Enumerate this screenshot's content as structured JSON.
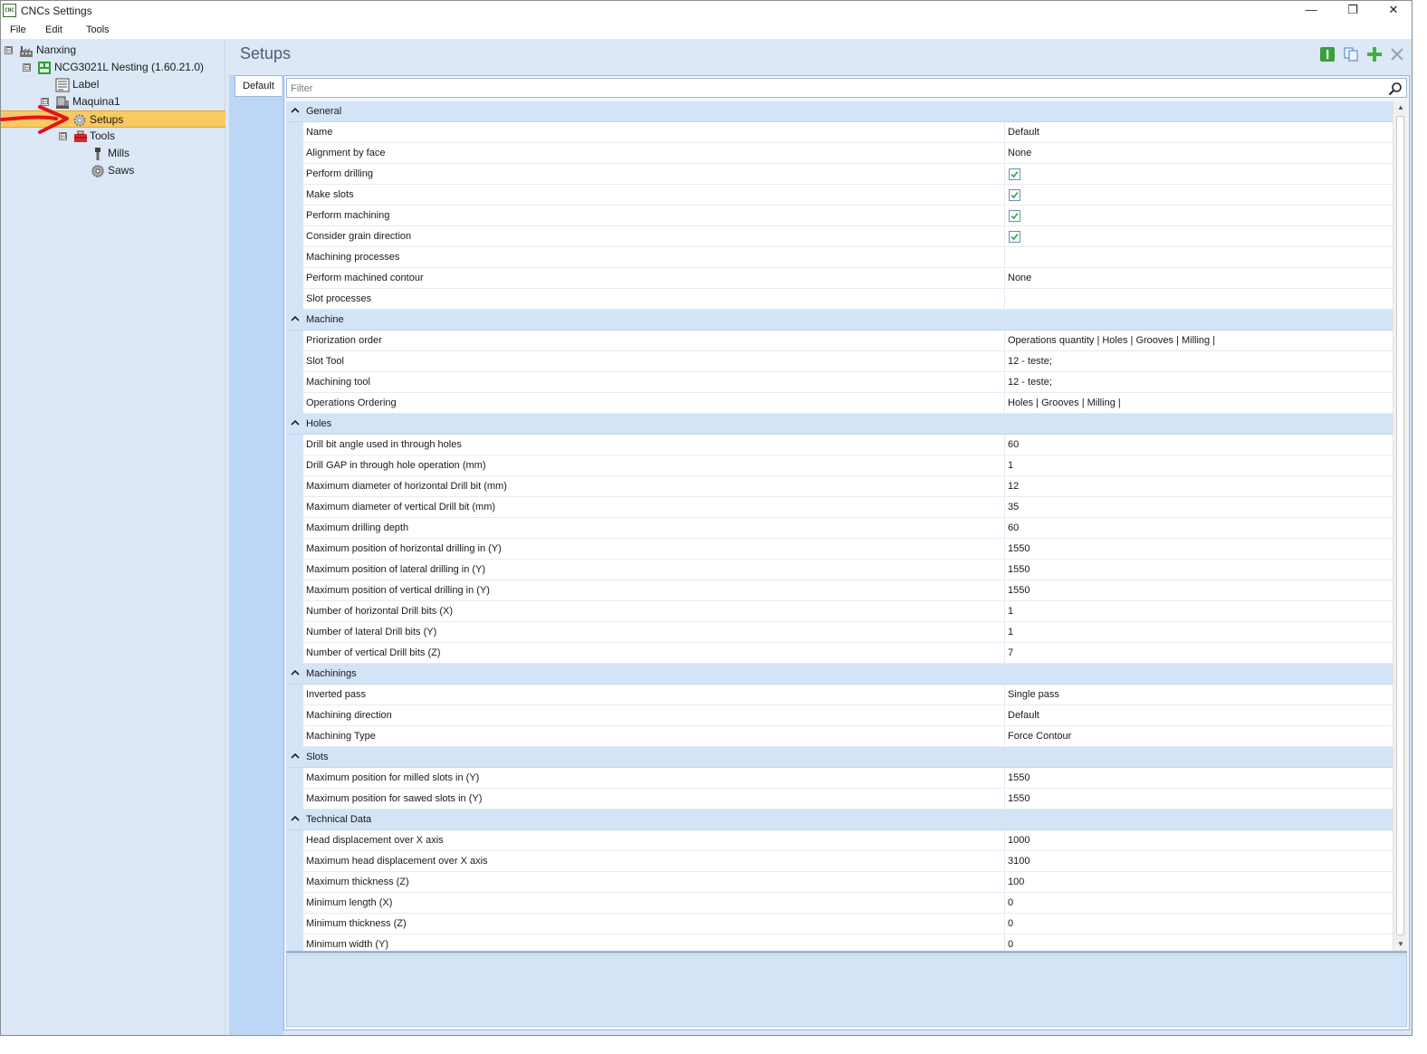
{
  "window": {
    "app_icon_text": "CNC",
    "title": "CNCs Settings",
    "minimize_symbol": "—",
    "restore_symbol": "❐",
    "close_symbol": "✕"
  },
  "menu": {
    "items": [
      "File",
      "Edit",
      "Tools"
    ]
  },
  "tree": {
    "nodes": [
      {
        "label": "Nanxing",
        "icon": "factory-icon",
        "expander": "⊟"
      },
      {
        "label": "NCG3021L Nesting (1.60.21.0)",
        "icon": "nesting-icon",
        "expander": "⊟"
      },
      {
        "label": "Label",
        "icon": "label-icon"
      },
      {
        "label": "Maquina1",
        "icon": "machine-icon",
        "expander": "⊟"
      },
      {
        "label": "Setups",
        "icon": "gear-icon",
        "selected": true
      },
      {
        "label": "Tools",
        "icon": "toolbox-icon",
        "expander": "⊟"
      },
      {
        "label": "Mills",
        "icon": "mill-icon"
      },
      {
        "label": "Saws",
        "icon": "saw-icon"
      }
    ]
  },
  "main": {
    "title": "Setups",
    "toolbar": [
      "info-icon",
      "copy-icon",
      "add-icon",
      "close-icon"
    ],
    "tab_default": "Default",
    "filter_placeholder": "Filter"
  },
  "grid": {
    "categories": [
      {
        "name": "General",
        "props": [
          {
            "name": "Name",
            "value": "Default"
          },
          {
            "name": "Alignment by face",
            "value": "None"
          },
          {
            "name": "Perform drilling",
            "checkbox": true
          },
          {
            "name": "Make slots",
            "checkbox": true
          },
          {
            "name": "Perform machining",
            "checkbox": true
          },
          {
            "name": "Consider grain direction",
            "checkbox": true
          },
          {
            "name": "Machining processes",
            "value": ""
          },
          {
            "name": "Perform machined contour",
            "value": "None"
          },
          {
            "name": "Slot processes",
            "value": ""
          }
        ]
      },
      {
        "name": "Machine",
        "props": [
          {
            "name": "Priorization order",
            "value": "Operations quantity | Holes | Grooves | Milling |"
          },
          {
            "name": "Slot Tool",
            "value": "12 - teste;"
          },
          {
            "name": "Machining tool",
            "value": "12 - teste;"
          },
          {
            "name": "Operations Ordering",
            "value": "Holes | Grooves | Milling |"
          }
        ]
      },
      {
        "name": "Holes",
        "props": [
          {
            "name": "Drill bit angle used in through holes",
            "value": "60"
          },
          {
            "name": "Drill GAP in through hole operation (mm)",
            "value": "1"
          },
          {
            "name": "Maximum diameter of horizontal Drill bit (mm)",
            "value": "12"
          },
          {
            "name": "Maximum diameter of vertical Drill bit (mm)",
            "value": "35"
          },
          {
            "name": "Maximum drilling depth",
            "value": "60"
          },
          {
            "name": "Maximum position of horizontal drilling in (Y)",
            "value": "1550"
          },
          {
            "name": "Maximum position of lateral drilling in (Y)",
            "value": "1550"
          },
          {
            "name": "Maximum position of vertical drilling in (Y)",
            "value": "1550"
          },
          {
            "name": "Number of horizontal Drill bits (X)",
            "value": "1"
          },
          {
            "name": "Number of lateral Drill bits (Y)",
            "value": "1"
          },
          {
            "name": "Number of vertical Drill bits (Z)",
            "value": "7"
          }
        ]
      },
      {
        "name": "Machinings",
        "props": [
          {
            "name": "Inverted pass",
            "value": "Single pass"
          },
          {
            "name": "Machining direction",
            "value": "Default"
          },
          {
            "name": "Machining Type",
            "value": "Force Contour"
          }
        ]
      },
      {
        "name": "Slots",
        "props": [
          {
            "name": "Maximum position for milled slots in (Y)",
            "value": "1550"
          },
          {
            "name": "Maximum position for sawed slots in (Y)",
            "value": "1550"
          }
        ]
      },
      {
        "name": "Technical Data",
        "props": [
          {
            "name": "Head displacement over X axis",
            "value": "1000"
          },
          {
            "name": "Maximum head displacement over X axis",
            "value": "3100"
          },
          {
            "name": "Maximum thickness (Z)",
            "value": "100"
          },
          {
            "name": "Minimum length (X)",
            "value": "0"
          },
          {
            "name": "Minimum thickness (Z)",
            "value": "0"
          },
          {
            "name": "Minimum width (Y)",
            "value": "0"
          }
        ]
      }
    ]
  },
  "colors": {
    "panel_bg": "#dce8f6",
    "selection": "#f9c962",
    "category_bg": "#d4e4f7",
    "annotation_arrow": "#e3141b"
  }
}
